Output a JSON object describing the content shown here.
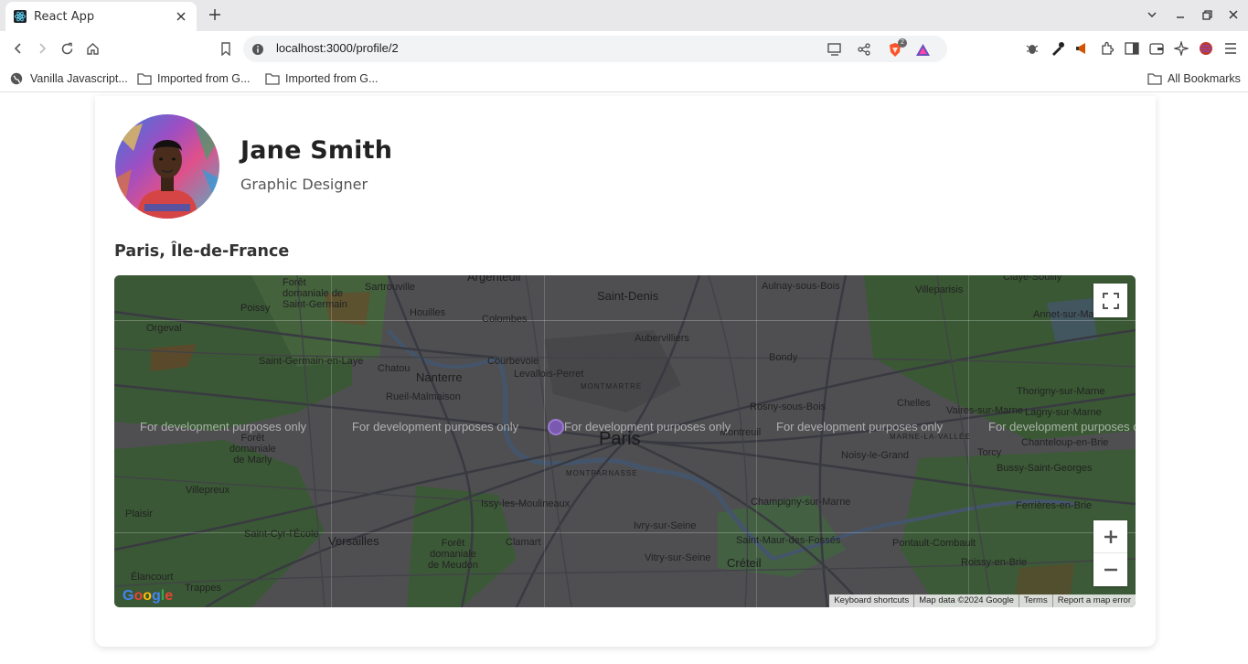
{
  "browser": {
    "tab_title": "React App",
    "url": "localhost:3000/profile/2",
    "shield_badge": "2",
    "bookmarks": [
      {
        "label": "Vanilla Javascript...",
        "icon": "globe-icon"
      },
      {
        "label": "Imported from G...",
        "icon": "folder-icon"
      },
      {
        "label": "Imported from G...",
        "icon": "folder-icon"
      }
    ],
    "all_bookmarks": "All Bookmarks"
  },
  "profile": {
    "name": "Jane Smith",
    "title": "Graphic Designer",
    "location": "Paris, Île-de-France",
    "avatar_icon": "avatar-photo"
  },
  "map": {
    "watermark": "For development purposes only",
    "labels": {
      "paris": "Paris",
      "saint_denis": "Saint-Denis",
      "argenteuil": "Argenteuil",
      "nanterre": "Nanterre",
      "versailles": "Versailles",
      "creteil": "Créteil",
      "sartrouville": "Sartrouville",
      "foret_sg": "Forêt\ndomaniale de\nSaint-Germain",
      "poissy": "Poissy",
      "houilles": "Houilles",
      "colombes": "Colombes",
      "aulnay": "Aulnay-sous-Bois",
      "villeparisis": "Villeparisis",
      "claye": "Claye-Souilly",
      "annet": "Annet-sur-Marne",
      "orgeval": "Orgeval",
      "aubervilliers": "Aubervilliers",
      "sglaye": "Saint-Germain-en-Laye",
      "chatou": "Chatou",
      "courbevoie": "Courbevoie",
      "levallois": "Levallois-Perret",
      "bondy": "Bondy",
      "montmartre": "MONTMARTRE",
      "rueil": "Rueil-Malmaison",
      "rosny": "Rosny-sous-Bois",
      "chelles": "Chelles",
      "thorigny": "Thorigny-sur-Marne",
      "vaires": "Vaires-sur-Marne",
      "lagny": "Lagny-sur-Marne",
      "montreuil": "Montreuil",
      "foret_marly": "Forêt\ndomaniale\nde Marly",
      "noisy": "Noisy-le-Grand",
      "marne_vallee": "MARNE-LA-VALLÉE",
      "chanteloup": "Chanteloup-en-Brie",
      "torcy": "Torcy",
      "bussy": "Bussy-Saint-Georges",
      "montparnasse": "MONTPARNASSE",
      "villepreux": "Villepreux",
      "issy": "Issy-les-Moulineaux",
      "champigny": "Champigny-sur-Marne",
      "ferrieres": "Ferrières-en-Brie",
      "plaisir": "Plaisir",
      "ivry": "Ivry-sur-Seine",
      "saint_cyr": "Saint-Cyr-l'École",
      "clamart": "Clamart",
      "foret_meudon": "Forêt\ndomaniale\nde Meudon",
      "vitry": "Vitry-sur-Seine",
      "saint_maur": "Saint-Maur-des-Fossés",
      "pontault": "Pontault-Combault",
      "roissy": "Roissy-en-Brie",
      "elancourt": "Élancourt",
      "trappes": "Trappes"
    },
    "attribution": [
      "Keyboard shortcuts",
      "Map data ©2024 Google",
      "Terms",
      "Report a map error"
    ],
    "logo": "Google"
  }
}
